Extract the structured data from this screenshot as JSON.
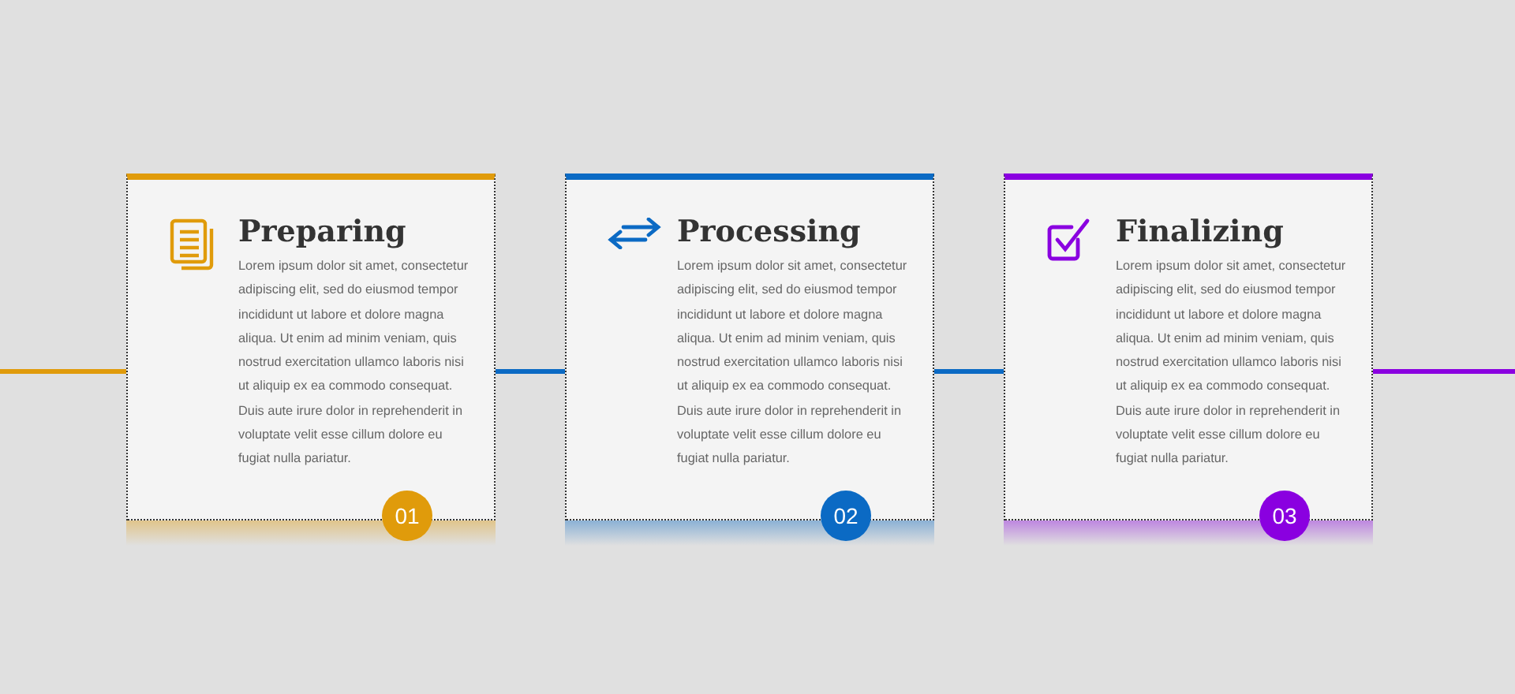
{
  "steps": [
    {
      "kind": "document",
      "title": "Preparing",
      "body": "Lorem ipsum dolor sit amet, consectetur adipiscing elit, sed do eiusmod tempor incididunt ut labore et dolore magna aliqua. Ut enim ad minim veniam, quis nostrud exercitation ullamco laboris nisi ut aliquip ex ea commodo consequat. Duis aute irure dolor in reprehenderit in voluptate velit esse cillum dolore eu fugiat nulla pariatur.",
      "number": "01",
      "color": "#e09b0b"
    },
    {
      "kind": "arrows",
      "title": "Processing",
      "body": "Lorem ipsum dolor sit amet, consectetur adipiscing elit, sed do eiusmod tempor incididunt ut labore et dolore magna aliqua. Ut enim ad minim veniam, quis nostrud exercitation ullamco laboris nisi ut aliquip ex ea commodo consequat. Duis aute irure dolor in reprehenderit in voluptate velit esse cillum dolore eu fugiat nulla pariatur.",
      "number": "02",
      "color": "#0b6ac4"
    },
    {
      "kind": "checkbox",
      "title": "Finalizing",
      "body": "Lorem ipsum dolor sit amet, consectetur adipiscing elit, sed do eiusmod tempor incididunt ut labore et dolore magna aliqua. Ut enim ad minim veniam, quis nostrud exercitation ullamco laboris nisi ut aliquip ex ea commodo consequat. Duis aute irure dolor in reprehenderit in voluptate velit esse cillum dolore eu fugiat nulla pariatur.",
      "number": "03",
      "color": "#8a00e0"
    }
  ]
}
